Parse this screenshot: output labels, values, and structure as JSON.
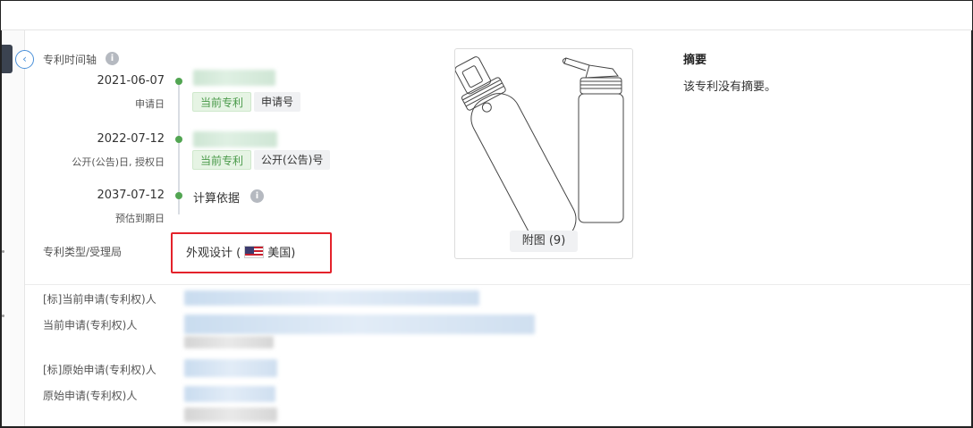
{
  "timeline": {
    "title": "专利时间轴",
    "items": [
      {
        "date": "2021-06-07",
        "label": "申请日",
        "tags": [
          "当前专利",
          "申请号"
        ]
      },
      {
        "date": "2022-07-12",
        "label": "公开(公告)日, 授权日",
        "tags": [
          "当前专利",
          "公开(公告)号"
        ]
      },
      {
        "date": "2037-07-12",
        "label": "预估到期日",
        "calc": "计算依据"
      }
    ]
  },
  "patent_type": {
    "label": "专利类型/受理局",
    "value": "外观设计 (",
    "country": "美国)"
  },
  "applicants": {
    "std_current": "[标]当前申请(专利权)人",
    "current": "当前申请(专利权)人",
    "std_original": "[标]原始申请(专利权)人",
    "original": "原始申请(专利权)人"
  },
  "figure": {
    "caption": "附图 (9)"
  },
  "abstract": {
    "title": "摘要",
    "text": "该专利没有摘要。"
  },
  "icons": {
    "collapse": "chevron-left-icon",
    "info": "info-icon",
    "flag": "us-flag-icon"
  }
}
